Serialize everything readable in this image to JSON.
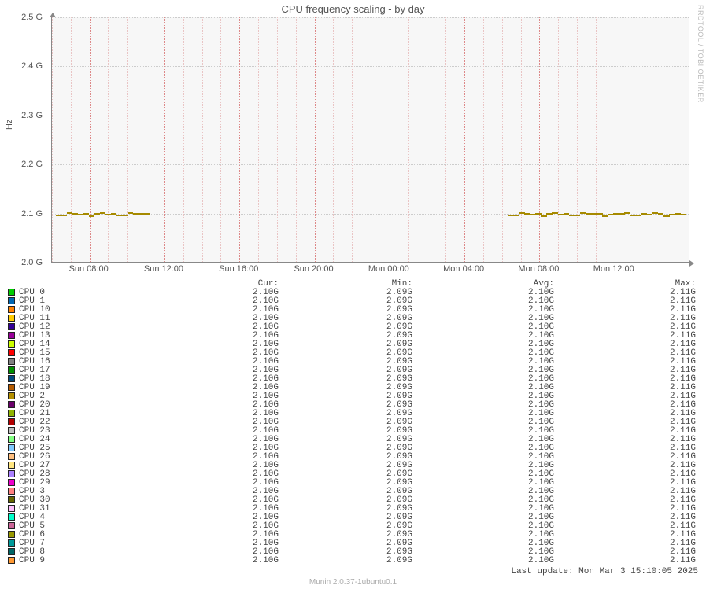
{
  "title": "CPU frequency scaling - by day",
  "ylabel": "Hz",
  "watermark": "RRDTOOL / TOBI OETIKER",
  "footer_version": "Munin 2.0.37-1ubuntu0.1",
  "footer_update": "Last update: Mon Mar  3 15:10:05 2025",
  "chart_data": {
    "type": "line",
    "title": "CPU frequency scaling - by day",
    "xlabel": "",
    "ylabel": "Hz",
    "ylim": [
      2.0,
      2.5
    ],
    "y_ticks": [
      "2.0 G",
      "2.1 G",
      "2.2 G",
      "2.3 G",
      "2.4 G",
      "2.5 G"
    ],
    "x_ticks": [
      "Sun 08:00",
      "Sun 12:00",
      "Sun 16:00",
      "Sun 20:00",
      "Mon 00:00",
      "Mon 04:00",
      "Mon 08:00",
      "Mon 12:00"
    ],
    "x_range_hours": 34,
    "visible_segments": [
      {
        "start_hour_index": 0.2,
        "end_hour_index": 5.2,
        "approx_value_G": 2.1
      },
      {
        "start_hour_index": 24.3,
        "end_hour_index": 33.8,
        "approx_value_G": 2.1
      }
    ],
    "series": [
      {
        "name": "CPU 0",
        "color": "#00cc00",
        "cur": "2.10G",
        "min": "2.09G",
        "avg": "2.10G",
        "max": "2.11G"
      },
      {
        "name": "CPU 1",
        "color": "#0066b3",
        "cur": "2.10G",
        "min": "2.09G",
        "avg": "2.10G",
        "max": "2.11G"
      },
      {
        "name": "CPU 10",
        "color": "#ff8000",
        "cur": "2.10G",
        "min": "2.09G",
        "avg": "2.10G",
        "max": "2.11G"
      },
      {
        "name": "CPU 11",
        "color": "#ffcc00",
        "cur": "2.10G",
        "min": "2.09G",
        "avg": "2.10G",
        "max": "2.11G"
      },
      {
        "name": "CPU 12",
        "color": "#330099",
        "cur": "2.10G",
        "min": "2.09G",
        "avg": "2.10G",
        "max": "2.11G"
      },
      {
        "name": "CPU 13",
        "color": "#990099",
        "cur": "2.10G",
        "min": "2.09G",
        "avg": "2.10G",
        "max": "2.11G"
      },
      {
        "name": "CPU 14",
        "color": "#ccff00",
        "cur": "2.10G",
        "min": "2.09G",
        "avg": "2.10G",
        "max": "2.11G"
      },
      {
        "name": "CPU 15",
        "color": "#ff0000",
        "cur": "2.10G",
        "min": "2.09G",
        "avg": "2.10G",
        "max": "2.11G"
      },
      {
        "name": "CPU 16",
        "color": "#808080",
        "cur": "2.10G",
        "min": "2.09G",
        "avg": "2.10G",
        "max": "2.11G"
      },
      {
        "name": "CPU 17",
        "color": "#008f00",
        "cur": "2.10G",
        "min": "2.09G",
        "avg": "2.10G",
        "max": "2.11G"
      },
      {
        "name": "CPU 18",
        "color": "#00487d",
        "cur": "2.10G",
        "min": "2.09G",
        "avg": "2.10G",
        "max": "2.11G"
      },
      {
        "name": "CPU 19",
        "color": "#b35a00",
        "cur": "2.10G",
        "min": "2.09G",
        "avg": "2.10G",
        "max": "2.11G"
      },
      {
        "name": "CPU 2",
        "color": "#b38f00",
        "cur": "2.10G",
        "min": "2.09G",
        "avg": "2.10G",
        "max": "2.11G"
      },
      {
        "name": "CPU 20",
        "color": "#6b006b",
        "cur": "2.10G",
        "min": "2.09G",
        "avg": "2.10G",
        "max": "2.11G"
      },
      {
        "name": "CPU 21",
        "color": "#8fb300",
        "cur": "2.10G",
        "min": "2.09G",
        "avg": "2.10G",
        "max": "2.11G"
      },
      {
        "name": "CPU 22",
        "color": "#b30000",
        "cur": "2.10G",
        "min": "2.09G",
        "avg": "2.10G",
        "max": "2.11G"
      },
      {
        "name": "CPU 23",
        "color": "#bebebe",
        "cur": "2.10G",
        "min": "2.09G",
        "avg": "2.10G",
        "max": "2.11G"
      },
      {
        "name": "CPU 24",
        "color": "#80ff80",
        "cur": "2.10G",
        "min": "2.09G",
        "avg": "2.10G",
        "max": "2.11G"
      },
      {
        "name": "CPU 25",
        "color": "#80c9ff",
        "cur": "2.10G",
        "min": "2.09G",
        "avg": "2.10G",
        "max": "2.11G"
      },
      {
        "name": "CPU 26",
        "color": "#ffc080",
        "cur": "2.10G",
        "min": "2.09G",
        "avg": "2.10G",
        "max": "2.11G"
      },
      {
        "name": "CPU 27",
        "color": "#ffe680",
        "cur": "2.10G",
        "min": "2.09G",
        "avg": "2.10G",
        "max": "2.11G"
      },
      {
        "name": "CPU 28",
        "color": "#aa80ff",
        "cur": "2.10G",
        "min": "2.09G",
        "avg": "2.10G",
        "max": "2.11G"
      },
      {
        "name": "CPU 29",
        "color": "#ee00cc",
        "cur": "2.10G",
        "min": "2.09G",
        "avg": "2.10G",
        "max": "2.11G"
      },
      {
        "name": "CPU 3",
        "color": "#ff8080",
        "cur": "2.10G",
        "min": "2.09G",
        "avg": "2.10G",
        "max": "2.11G"
      },
      {
        "name": "CPU 30",
        "color": "#666600",
        "cur": "2.10G",
        "min": "2.09G",
        "avg": "2.10G",
        "max": "2.11G"
      },
      {
        "name": "CPU 31",
        "color": "#ffbfff",
        "cur": "2.10G",
        "min": "2.09G",
        "avg": "2.10G",
        "max": "2.11G"
      },
      {
        "name": "CPU 4",
        "color": "#00ffcc",
        "cur": "2.10G",
        "min": "2.09G",
        "avg": "2.10G",
        "max": "2.11G"
      },
      {
        "name": "CPU 5",
        "color": "#cc6699",
        "cur": "2.10G",
        "min": "2.09G",
        "avg": "2.10G",
        "max": "2.11G"
      },
      {
        "name": "CPU 6",
        "color": "#999900",
        "cur": "2.10G",
        "min": "2.09G",
        "avg": "2.10G",
        "max": "2.11G"
      },
      {
        "name": "CPU 7",
        "color": "#009999",
        "cur": "2.10G",
        "min": "2.09G",
        "avg": "2.10G",
        "max": "2.11G"
      },
      {
        "name": "CPU 8",
        "color": "#006666",
        "cur": "2.10G",
        "min": "2.09G",
        "avg": "2.10G",
        "max": "2.11G"
      },
      {
        "name": "CPU 9",
        "color": "#ff9933",
        "cur": "2.10G",
        "min": "2.09G",
        "avg": "2.10G",
        "max": "2.11G"
      }
    ],
    "legend_headers": {
      "cur": "Cur:",
      "min": "Min:",
      "avg": "Avg:",
      "max": "Max:"
    }
  }
}
